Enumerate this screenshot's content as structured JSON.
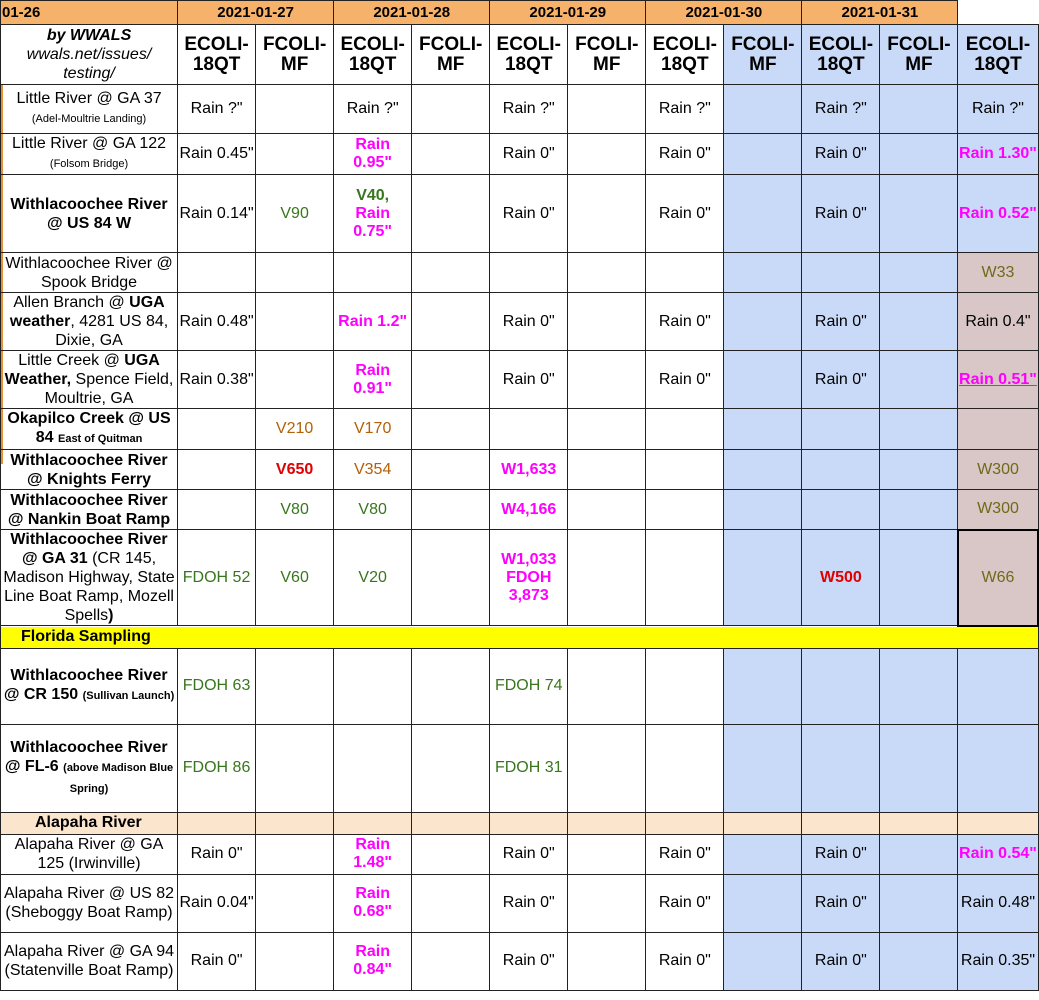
{
  "dates": [
    "01-26",
    "2021-01-27",
    "2021-01-28",
    "2021-01-29",
    "2021-01-30",
    "2021-01-31"
  ],
  "header": {
    "source_by": "by WWALS",
    "source_site": "wwals.net/issues/ testing/",
    "fcoli": "FCOLI-MF",
    "ecoli": "ECOLI-18QT"
  },
  "sections": {
    "florida": "Florida Sampling",
    "alapaha": "Alapaha River"
  },
  "rows": [
    {
      "site": "Little River @ GA 37",
      "sub": "(Adel-Moultrie Landing)",
      "c": [
        "Rain ?\"",
        "",
        "Rain ?\"",
        "",
        "Rain ?\"",
        "",
        "Rain ?\"",
        "",
        "Rain ?\"",
        "",
        "Rain ?\""
      ]
    },
    {
      "site": "Little River @ GA 122",
      "sub": "(Folsom Bridge)",
      "c": [
        "Rain 0.45\"",
        "",
        "Rain 0.95\"",
        "",
        "Rain 0\"",
        "",
        "Rain 0\"",
        "",
        "Rain 0\"",
        "",
        "Rain 1.30\""
      ]
    },
    {
      "site": "Withlacoochee River @ US 84 W",
      "c": [
        "Rain 0.14\"",
        "V90",
        "V40,",
        "Rain 0.75\"",
        "Rain 0\"",
        "",
        "Rain 0\"",
        "",
        "Rain 0\"",
        "",
        "Rain 0.52\""
      ]
    },
    {
      "site": "Withlacoochee River @ Spook Bridge",
      "c": [
        "W33"
      ]
    },
    {
      "site": "Allen Branch @",
      "b1": "UGA weather",
      "rest": ", 4281 US 84, Dixie, GA",
      "c": [
        "Rain 0.48\"",
        "",
        "Rain 1.2\"",
        "",
        "Rain 0\"",
        "",
        "Rain 0\"",
        "",
        "Rain 0\"",
        "",
        "Rain 0.4\""
      ]
    },
    {
      "site": "Little Creek @",
      "b1": "UGA Weather,",
      "rest": "Spence Field, Moultrie, GA",
      "c": [
        "Rain 0.38\"",
        "",
        "Rain 0.91\"",
        "",
        "Rain 0\"",
        "",
        "Rain 0\"",
        "",
        "Rain 0\"",
        "",
        "Rain 0.51\""
      ]
    },
    {
      "site": "Okapilco Creek @ US 84",
      "sub": "East of Quitman",
      "c": [
        "V210",
        "V170"
      ]
    },
    {
      "site": "Withlacoochee River @ Knights Ferry",
      "c": [
        "V650",
        "V354",
        "W1,633",
        "W300"
      ]
    },
    {
      "site": "Withlacoochee River @ Nankin Boat Ramp",
      "c": [
        "V80",
        "V80",
        "W4,166",
        "W300"
      ]
    },
    {
      "site": "Withlacoochee River @ GA 31",
      "rest": "(CR 145, Madison Highway, State Line Boat Ramp, Mozell Spells",
      "tail": ")",
      "c": [
        "FDOH 52",
        "V60",
        "V20",
        "W1,033",
        "FDOH",
        "3,873",
        "W500",
        "W66"
      ]
    },
    {
      "site": "Withlacoochee River @ CR 150",
      "sub": "(Sullivan Launch)",
      "c": [
        "FDOH 63",
        "FDOH 74"
      ]
    },
    {
      "site": "Withlacoochee River @ FL-6",
      "sub": "(above Madison Blue Spring)",
      "c": [
        "FDOH 86",
        "FDOH 31"
      ]
    },
    {
      "site": "Alapaha River @ GA 125 (Irwinville)",
      "c": [
        "Rain 0\"",
        "",
        "Rain 1.48\"",
        "",
        "Rain 0\"",
        "",
        "Rain 0\"",
        "",
        "Rain 0\"",
        "",
        "Rain 0.54\""
      ]
    },
    {
      "site": "Alapaha River @ US 82 (Sheboggy Boat Ramp)",
      "c": [
        "Rain 0.04\"",
        "",
        "Rain 0.68\"",
        "",
        "Rain 0\"",
        "",
        "Rain 0\"",
        "",
        "Rain 0\"",
        "",
        "Rain 0.48\""
      ]
    },
    {
      "site": "Alapaha River @ GA 94 (Statenville Boat Ramp)",
      "c": [
        "Rain 0\"",
        "",
        "Rain 0.84\"",
        "",
        "Rain 0\"",
        "",
        "Rain 0\"",
        "",
        "Rain 0\"",
        "",
        "Rain 0.35\""
      ]
    }
  ],
  "colors": {
    "header_orange": "#f6b26b",
    "blue": "#c9daf8",
    "yellow": "#ffff00",
    "peach": "#fce5cd",
    "magenta": "#ff00ff",
    "green": "#38761d",
    "red": "#e00000"
  }
}
